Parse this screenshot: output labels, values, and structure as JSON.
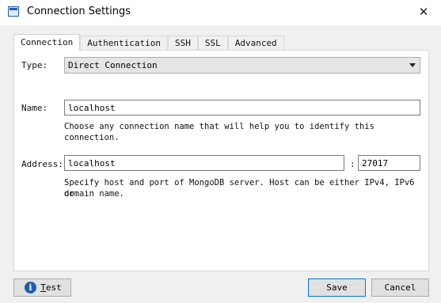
{
  "window": {
    "title": "Connection Settings",
    "close_glyph": "✕",
    "icon": "app-window-icon"
  },
  "tabs": [
    {
      "label": "Connection",
      "active": true
    },
    {
      "label": "Authentication",
      "active": false
    },
    {
      "label": "SSH",
      "active": false
    },
    {
      "label": "SSL",
      "active": false
    },
    {
      "label": "Advanced",
      "active": false
    }
  ],
  "connection": {
    "type_label": "Type:",
    "type_value": "Direct Connection",
    "name_label": "Name:",
    "name_value": "localhost",
    "name_help": "Choose any connection name that will help you to identify this connection.",
    "address_label": "Address:",
    "address_host": "localhost",
    "address_sep": ":",
    "address_port": "27017",
    "address_help_1": "Specify host and port of MongoDB server. Host can be either IPv4, IPv6 or",
    "address_help_2": "domain name."
  },
  "buttons": {
    "test_first": "T",
    "test_rest": "est",
    "save": "Save",
    "cancel": "Cancel"
  }
}
